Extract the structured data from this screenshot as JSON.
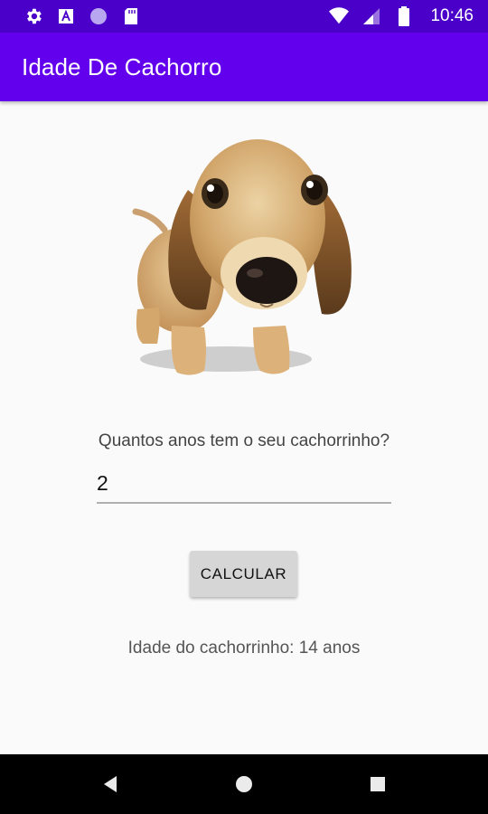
{
  "status_bar": {
    "time": "10:46",
    "left_icons": [
      "gear-icon",
      "text-a-icon",
      "circle-icon",
      "sd-card-icon"
    ],
    "right_icons": [
      "wifi-icon",
      "signal-icon",
      "battery-icon"
    ]
  },
  "app_bar": {
    "title": "Idade De Cachorro",
    "color": "#6200ee"
  },
  "main": {
    "image": "puppy-dog-image",
    "question": "Quantos anos tem o seu cachorrinho?",
    "age_input_value": "2",
    "calculate_label": "CALCULAR",
    "result": "Idade do cachorrinho: 14 anos"
  },
  "nav_bar": {
    "buttons": [
      "back-icon",
      "home-icon",
      "recents-icon"
    ]
  }
}
